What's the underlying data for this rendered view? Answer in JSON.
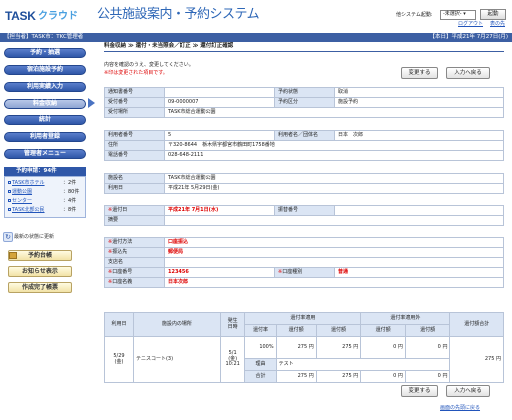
{
  "header": {
    "logo_task": "TASK",
    "logo_cloud": "クラウド",
    "title": "公共施設案内・予約システム",
    "sys_label": "他システム起動:",
    "sys_select": "-未選択-",
    "start_button": "起動",
    "logout": "ログアウト",
    "table_top": "表の先"
  },
  "topbar": {
    "left": "【担当者】TASK市：TKC管理者",
    "right": "【本日】平成21年 7月27日(月)"
  },
  "sidebar": {
    "menu": [
      "予約・抽選",
      "宿泊施設予約",
      "利用実績入力",
      "料金収納",
      "統計",
      "利用者登録",
      "管理者メニュー"
    ],
    "pending_title": "予約申請：94件",
    "pending": [
      {
        "name": "TASK市ホテル",
        "count": "：2件"
      },
      {
        "name": "運動公園",
        "count": "：80件"
      },
      {
        "name": "センター",
        "count": "：4件"
      },
      {
        "name": "TASK北部公民",
        "count": "：8件"
      }
    ],
    "refresh": "最新の状態に更新",
    "buttons": [
      "予約台帳",
      "お知らせ表示",
      "作成完了帳票"
    ]
  },
  "breadcrumb": {
    "items": [
      "料金収納",
      "≫",
      "還付・未当照会／訂正",
      "≫",
      "還付訂正確認"
    ]
  },
  "notes": {
    "line1": "内容を確認のうえ、変更してください。",
    "line2": "※印は変更された項目です。"
  },
  "buttons": {
    "change": "変更する",
    "back": "入力へ戻る"
  },
  "form1": {
    "notice_no_label": "通知書番号",
    "notice_no": "",
    "status_label": "予約状態",
    "status": "取消",
    "receipt_no_label": "受付番号",
    "receipt_no": "09-0000007",
    "type_label": "予約区分",
    "type": "施設予約",
    "place_label": "受付場所",
    "place": "TASK市総合運動公園"
  },
  "form2": {
    "user_no_label": "利用者番号",
    "user_no": "5",
    "user_name_label": "利用者名／団体名",
    "user_name": "日本　次郎",
    "address_label": "住所",
    "address": "〒320-8644　栃木県宇都宮市鶴田町1758番地",
    "tel_label": "電話番号",
    "tel": "028-648-2111"
  },
  "form3": {
    "facility_label": "施設名",
    "facility": "TASK市総合運動公園",
    "date_label": "利用日",
    "date": "平成21年 5月29日(金)"
  },
  "form4": {
    "refund_date_label": "還付日",
    "refund_date": "平成21年 7月1日(水)",
    "receipt_label": "振替番号",
    "receipt": "",
    "remark_label": "摘要",
    "remark": ""
  },
  "form5": {
    "method_label": "還付方法",
    "method": "口座振込",
    "bank_label": "振込先",
    "bank": "郵便局",
    "branch_label": "支店名",
    "branch": "",
    "account_no_label": "口座番号",
    "account_no": "123456",
    "account_type_label": "口座種別",
    "account_type": "普通",
    "account_name_label": "口座名義",
    "account_name": "日本次郎"
  },
  "detail": {
    "h_date": "利用日",
    "h_place": "施設内の場所",
    "h_occur": "発生",
    "h_occur2": "日時",
    "h_normal": "還付率適用",
    "h_nonapp": "還付率適用外",
    "h_total": "還付額合計",
    "h_rate": "還付率",
    "h_amount": "還付額",
    "h_refund_amount": "還付額",
    "row_date": "5/29",
    "row_date2": "(金)",
    "row_place": "テニスコート(3)",
    "row_occ1": "5/1",
    "row_occ2": "(金)",
    "row_occ3": "10:21",
    "row_rate": "100%",
    "row_a1": "275 円",
    "row_a2": "275 円",
    "row_a3": "0 円",
    "row_a4": "0 円",
    "row_total": "275 円",
    "reason_label": "理由",
    "reason": "テスト",
    "sum_label": "合計",
    "sum_a1": "275 円",
    "sum_a2": "275 円",
    "sum_a3": "0 円",
    "sum_a4": "0 円",
    "sum_total": "275 円"
  },
  "footer": {
    "top_link": "画面の先頭に戻る"
  }
}
